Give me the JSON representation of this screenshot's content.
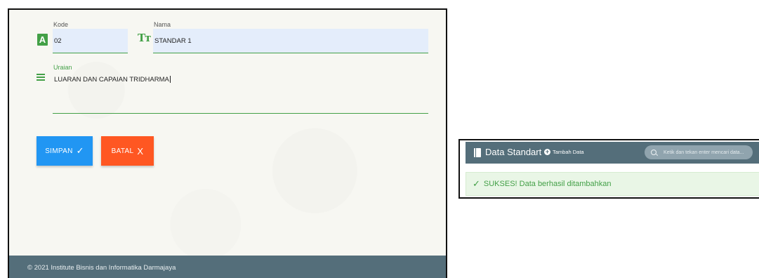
{
  "form": {
    "kode": {
      "label": "Kode",
      "value": "02"
    },
    "nama": {
      "label": "Nama",
      "value": "STANDAR 1"
    },
    "uraian": {
      "label": "Uraian",
      "value": "LUARAN DAN CAPAIAN TRIDHARMA"
    },
    "icons": {
      "kode_icon_letter": "A",
      "nama_icon_letters": "Tт"
    },
    "buttons": {
      "simpan_label": "SIMPAN",
      "simpan_symbol": "✓",
      "batal_label": "BATAL",
      "batal_symbol": "X"
    }
  },
  "footer": {
    "text": "© 2021 Institute Bisnis dan Informatika Darmajaya"
  },
  "data_standart": {
    "title": "Data Standart",
    "add_label": "Tambah Data",
    "search_placeholder": "Ketik dan tekan enter mencari data...",
    "success_symbol": "✓",
    "success_message": "SUKSES! Data berhasil ditambahkan"
  },
  "colors": {
    "accent_green": "#43a047",
    "primary_blue": "#2196f3",
    "danger_orange": "#ff5722",
    "header_slate": "#546e7a"
  }
}
